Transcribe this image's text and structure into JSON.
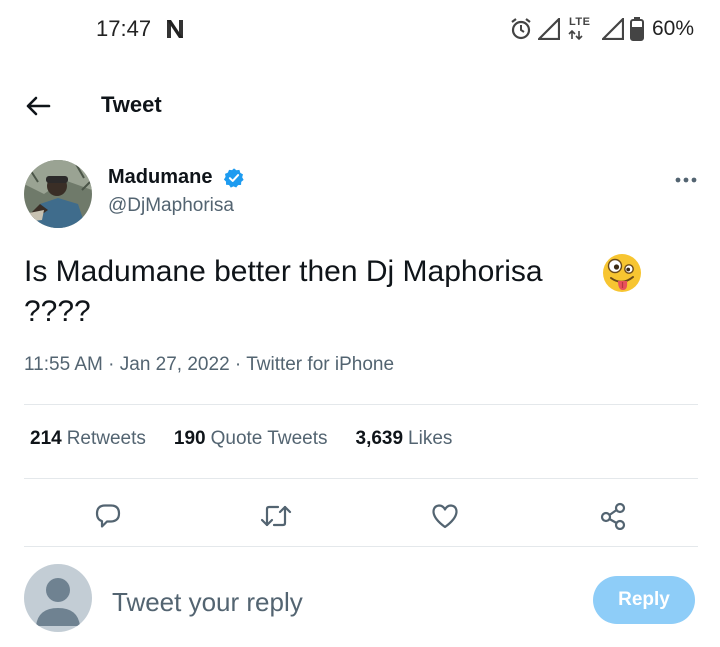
{
  "status_bar": {
    "time": "17:47",
    "battery": "60%",
    "network_label": "LTE",
    "icons": [
      "netflix-icon",
      "alarm-icon",
      "signal-icon",
      "lte-icon",
      "signal-icon",
      "battery-icon"
    ]
  },
  "header": {
    "title": "Tweet",
    "back_icon": "back-arrow-icon"
  },
  "tweet": {
    "display_name": "Madumane",
    "handle": "@DjMaphorisa",
    "verified": true,
    "text": "Is Madumane better then Dj Maphorisa\n????",
    "emoji": "zany-face",
    "time": "11:55 AM",
    "date": "Jan 27, 2022",
    "source": "Twitter for iPhone",
    "separator": "·"
  },
  "stats": {
    "retweets_count": "214",
    "retweets_label": "Retweets",
    "quotes_count": "190",
    "quotes_label": "Quote Tweets",
    "likes_count": "3,639",
    "likes_label": "Likes"
  },
  "actions": [
    "reply-icon",
    "retweet-icon",
    "like-icon",
    "share-icon"
  ],
  "reply": {
    "placeholder": "Tweet your reply",
    "button_label": "Reply"
  },
  "colors": {
    "accent": "#1d9bf0",
    "reply_button_disabled": "#8ecdf8",
    "secondary_text": "#536471",
    "divider": "#e4e8eb"
  }
}
